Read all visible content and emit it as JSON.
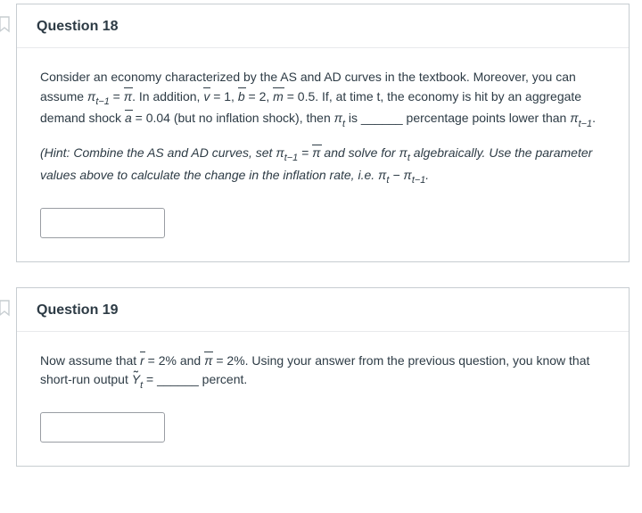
{
  "questions": [
    {
      "number_label": "Question 18",
      "body": {
        "intro_pre": "Consider an economy characterized by the AS and AD curves in the textbook. Moreover, you can assume ",
        "pi_tm1_eq_pibar": "π",
        "sub_tm1": "t−1",
        "eq_pi_bar": " = ",
        "pi_bar": "π",
        "in_addition": ". In addition, ",
        "vbar": "v",
        "eq1": " = 1, ",
        "bbar": "b",
        "eq2": " = 2, ",
        "mbar": "m",
        "eq05": " = 0.5. If, at time t, the economy is hit by an aggregate demand shock ",
        "abar": "a",
        "eq004": " = 0.04 (but no inflation shock), then ",
        "pi_t": "π",
        "sub_t": "t",
        "is_blank": " is ______ percentage points lower than ",
        "pi_tm1b": "π",
        "period": ".",
        "hint_pre": "(Hint: Combine the AS and AD curves, set ",
        "hint_eq": " = ",
        "hint_mid": " and solve for ",
        "hint_after": " algebraically. Use the parameter values above to calculate the change in the inflation rate, i.e. ",
        "minus": " − ",
        "hint_end": "."
      }
    },
    {
      "number_label": "Question 19",
      "body": {
        "pre": "Now assume that ",
        "rbar": "r",
        "eq2pct": " = 2% and ",
        "pibar": "π",
        "eq2pct2": " = 2%. Using your answer from the previous question, you know that short-run output ",
        "Yt": "Y",
        "sub_t": "t",
        "eq_blank": " = ______ percent."
      }
    }
  ]
}
